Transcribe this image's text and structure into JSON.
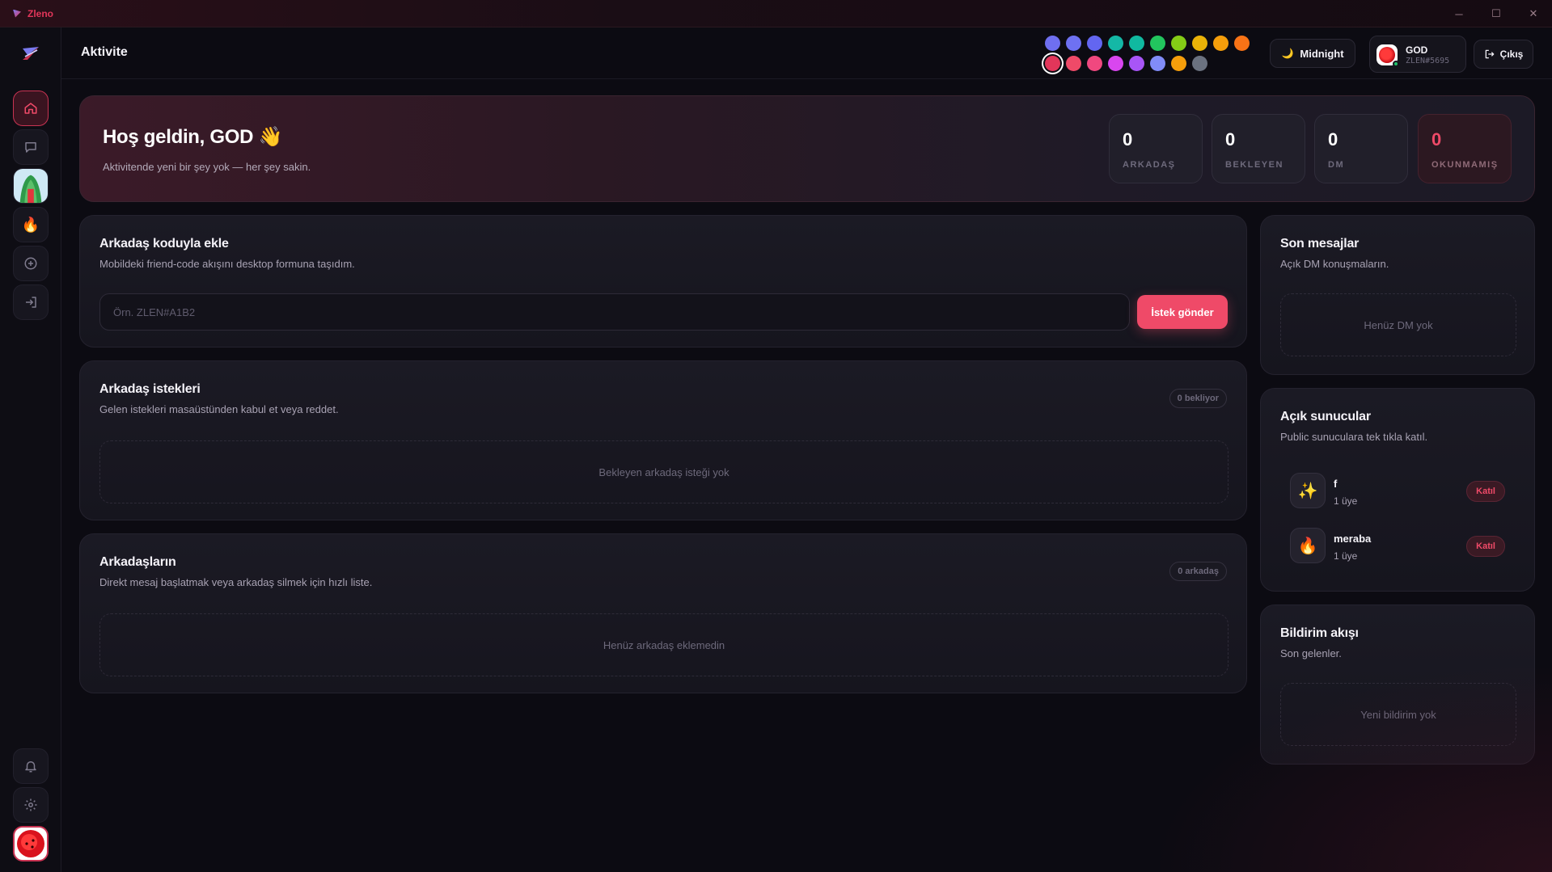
{
  "window": {
    "title": "Zleno",
    "controls": {
      "minimize": "─",
      "maximize": "☐",
      "close": "✕"
    }
  },
  "rail": {
    "items": [
      {
        "name": "home",
        "icon": "home-icon"
      },
      {
        "name": "messages",
        "icon": "chat-icon"
      },
      {
        "name": "server-1",
        "icon": "server-avatar-icon"
      },
      {
        "name": "server-2",
        "icon": "fire-icon",
        "glyph": "🔥"
      },
      {
        "name": "add-server",
        "icon": "plus-circle-icon"
      },
      {
        "name": "join",
        "icon": "login-icon"
      }
    ],
    "bottom": [
      {
        "name": "notifications",
        "icon": "bell-icon"
      },
      {
        "name": "settings",
        "icon": "gear-icon"
      },
      {
        "name": "profile",
        "icon": "avatar"
      }
    ]
  },
  "header": {
    "title": "Aktivite",
    "swatches_row1": [
      "#6f6ff0",
      "#6e71f2",
      "#6366f1",
      "#14b8a6",
      "#10b9a0",
      "#22c55e",
      "#84cc16",
      "#eab308",
      "#f59e0b",
      "#f97316"
    ],
    "swatches_row2": [
      "#e2365a",
      "#ef4a68",
      "#f0487f",
      "#d946ef",
      "#a855f7",
      "#818cf8",
      "#f59e0b",
      "#6b7280"
    ],
    "selected_swatch": "#e2365a",
    "theme": {
      "label": "Midnight",
      "icon": "moon-icon",
      "glyph": "🌙"
    },
    "user": {
      "name": "GOD",
      "tag": "ZLEN#5695",
      "status": "online"
    },
    "logout": {
      "label": "Çıkış",
      "icon": "logout-icon"
    }
  },
  "hero": {
    "title": "Hoş geldin, GOD 👋",
    "subtitle": "Aktivitende yeni bir şey yok — her şey sakin.",
    "stats": [
      {
        "value": "0",
        "label": "ARKADAŞ"
      },
      {
        "value": "0",
        "label": "BEKLEYEN"
      },
      {
        "value": "0",
        "label": "DM"
      },
      {
        "value": "0",
        "label": "OKUNMAMIŞ",
        "highlight": true
      }
    ]
  },
  "add_friend": {
    "title": "Arkadaş koduyla ekle",
    "subtitle": "Mobildeki friend-code akışını desktop formuna taşıdım.",
    "placeholder": "Örn. ZLEN#A1B2",
    "button": "İstek gönder"
  },
  "requests": {
    "title": "Arkadaş istekleri",
    "subtitle": "Gelen istekleri masaüstünden kabul et veya reddet.",
    "badge": "0 bekliyor",
    "empty": "Bekleyen arkadaş isteği yok"
  },
  "friends": {
    "title": "Arkadaşların",
    "subtitle": "Direkt mesaj başlatmak veya arkadaş silmek için hızlı liste.",
    "badge": "0 arkadaş",
    "empty": "Henüz arkadaş eklemedin"
  },
  "recent_messages": {
    "title": "Son mesajlar",
    "subtitle": "Açık DM konuşmaların.",
    "empty": "Henüz DM yok"
  },
  "public_servers": {
    "title": "Açık sunucular",
    "subtitle": "Public sunuculara tek tıkla katıl.",
    "items": [
      {
        "name": "f",
        "members": "1 üye",
        "icon": "sparkles-icon",
        "glyph": "✨",
        "action": "Katıl"
      },
      {
        "name": "meraba",
        "members": "1 üye",
        "icon": "fire-icon",
        "glyph": "🔥",
        "action": "Katıl"
      }
    ]
  },
  "notifications": {
    "title": "Bildirim akışı",
    "subtitle": "Son gelenler.",
    "empty": "Yeni bildirim yok"
  },
  "colors": {
    "accent": "#ef4a68",
    "background": "#0c0b12",
    "card": "#1b1a24"
  }
}
